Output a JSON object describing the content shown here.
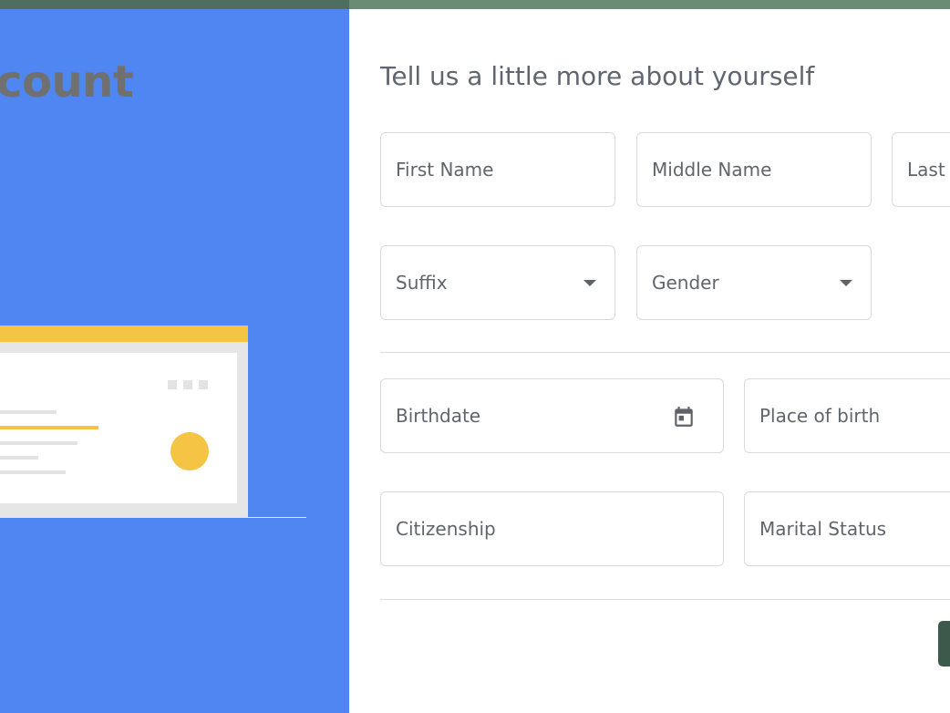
{
  "left_panel": {
    "title": "er Account"
  },
  "form": {
    "heading": "Tell us a little more about yourself",
    "fields": {
      "first_name": {
        "placeholder": "First Name"
      },
      "middle_name": {
        "placeholder": "Middle Name"
      },
      "last_name": {
        "placeholder": "Last"
      },
      "suffix": {
        "placeholder": "Suffix",
        "type": "select"
      },
      "gender": {
        "placeholder": "Gender",
        "type": "select"
      },
      "birthdate": {
        "placeholder": "Birthdate",
        "icon": "calendar-icon"
      },
      "place_of_birth": {
        "placeholder": "Place of birth"
      },
      "citizenship": {
        "placeholder": "Citizenship"
      },
      "marital_status": {
        "placeholder": "Marital Status"
      }
    }
  },
  "colors": {
    "top_bar_left": "#4e6e60",
    "top_bar_right": "#6b8b74",
    "panel_background": "#4f86f2",
    "illustration_accent": "#f6c444",
    "button_accent": "#3c5a4c"
  }
}
